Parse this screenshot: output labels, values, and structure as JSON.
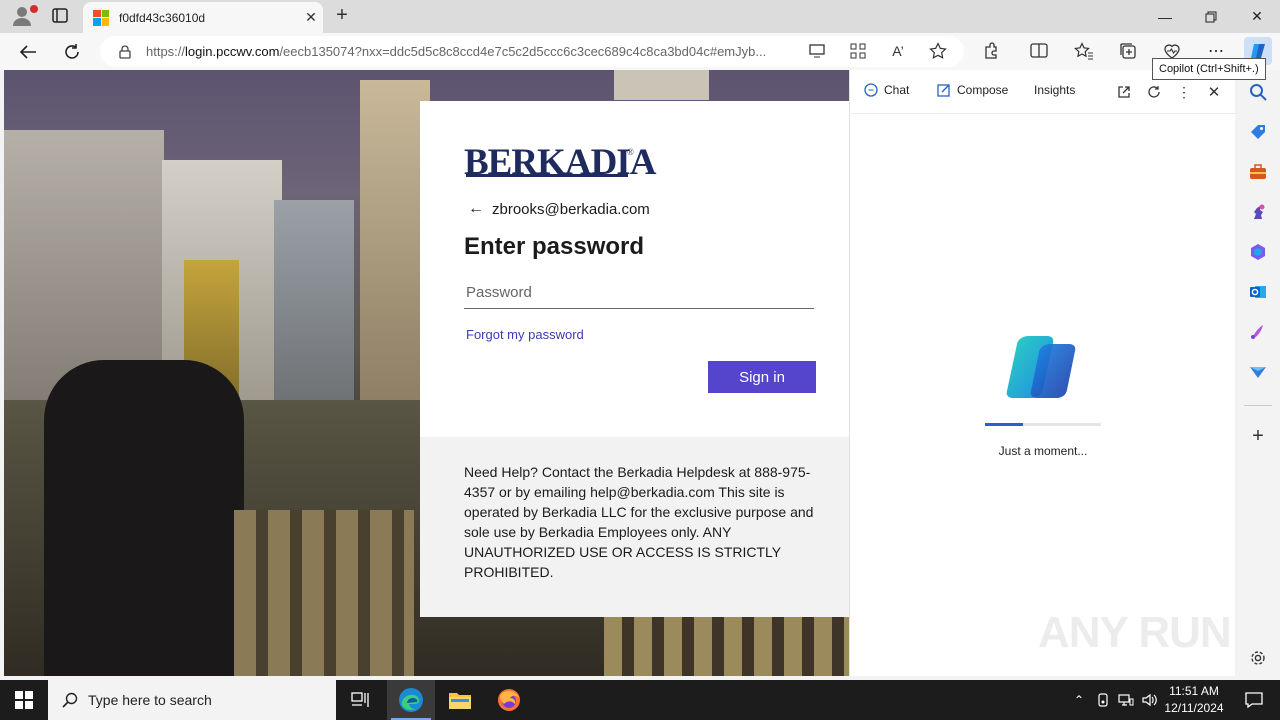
{
  "browser": {
    "tab_title": "f0dfd43c36010d",
    "url_prefix": "https://",
    "url_host": "login.pccwv.com",
    "url_path": "/eecb135074?nxx=ddc5d5c8c8ccd4e7c5c2d5ccc6c3cec689c4c8ca3bd04c#emJyb...",
    "tooltip": "Copilot (Ctrl+Shift+.)"
  },
  "login": {
    "logo_text": "BERKADIA",
    "email": "zbrooks@berkadia.com",
    "heading": "Enter password",
    "password_placeholder": "Password",
    "forgot_link": "Forgot my password",
    "signin_label": "Sign in",
    "help_text": "Need Help? Contact the Berkadia Helpdesk at 888-975-4357 or by emailing help@berkadia.com This site is operated by Berkadia LLC for the exclusive purpose and sole use by Berkadia Employees only. ANY UNAUTHORIZED USE OR ACCESS IS STRICTLY PROHIBITED."
  },
  "copilot": {
    "tabs": [
      "Chat",
      "Compose",
      "Insights"
    ],
    "loading_text": "Just a moment...",
    "progress": 0.33
  },
  "taskbar": {
    "search_placeholder": "Type here to search",
    "time": "11:51 AM",
    "date": "12/11/2024"
  },
  "watermark": "ANY RUN",
  "colors": {
    "accent": "#5445cc",
    "link": "#3d3cb0",
    "logo": "#1f2b5e"
  }
}
